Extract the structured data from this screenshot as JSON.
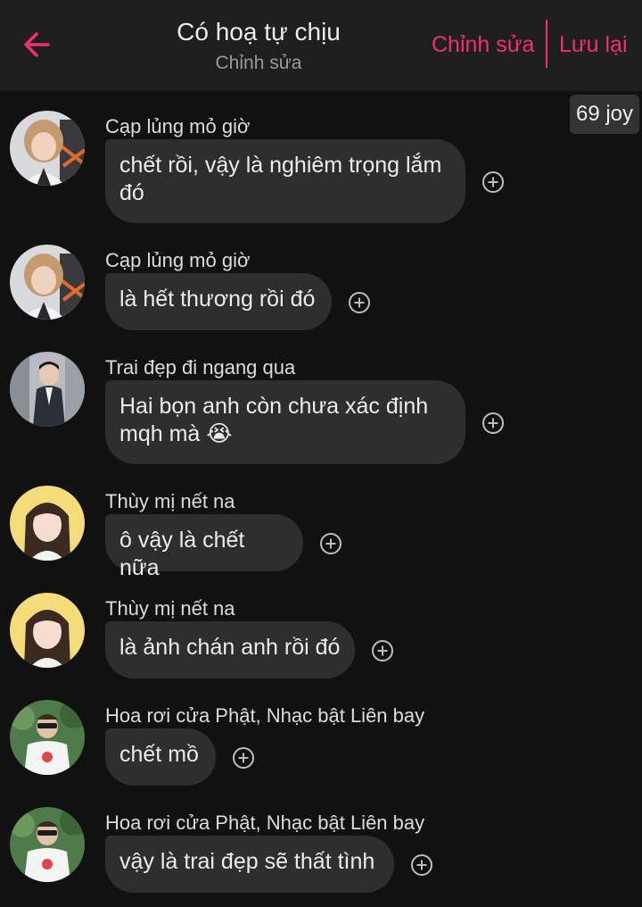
{
  "header": {
    "title": "Có hoạ tự chịu",
    "subtitle": "Chỉnh sửa",
    "edit_label": "Chỉnh sửa",
    "save_label": "Lưu lại",
    "accent_color": "#ef2f77"
  },
  "badge": {
    "joy": "69 joy"
  },
  "messages": [
    {
      "sender": "Cạp lủng mỏ giờ",
      "text": "chết rồi, vậy là nghiêm trọng lắm đó"
    },
    {
      "sender": "Cạp lủng mỏ giờ",
      "text": "là hết thương rồi đó"
    },
    {
      "sender": "Trai đẹp đi ngang qua",
      "text": "Hai bọn anh còn chưa xác định mqh mà 😭"
    },
    {
      "sender": "Thùy mị nết na",
      "text": "ô vậy là chết nữa"
    },
    {
      "sender": "Thùy mị nết na",
      "text": "là ảnh chán anh rồi đó"
    },
    {
      "sender": "Hoa rơi cửa Phật, Nhạc bật Liên bay",
      "text": "chết mồ"
    },
    {
      "sender": "Hoa rơi cửa Phật, Nhạc bật Liên bay",
      "text": "vậy là trai đẹp sẽ thất tình"
    }
  ]
}
